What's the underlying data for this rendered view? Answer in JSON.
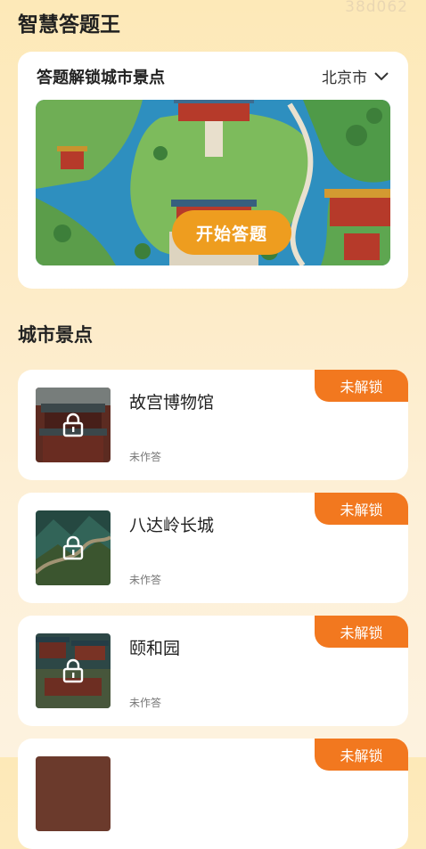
{
  "watermark": "38d062",
  "app": {
    "title": "智慧答题王"
  },
  "hero": {
    "title": "答题解锁城市景点",
    "city": "北京市",
    "start_label": "开始答题"
  },
  "section": {
    "title": "城市景点"
  },
  "spots": [
    {
      "name": "故宫博物馆",
      "status": "未作答",
      "badge": "未解锁"
    },
    {
      "name": "八达岭长城",
      "status": "未作答",
      "badge": "未解锁"
    },
    {
      "name": "颐和园",
      "status": "未作答",
      "badge": "未解锁"
    },
    {
      "name": "",
      "status": "",
      "badge": "未解锁"
    }
  ],
  "colors": {
    "accent": "#ee9d1f",
    "badge": "#f2781f",
    "background": "#fde9b8"
  },
  "icons": {
    "dropdown": "chevron-down-icon",
    "lock": "lock-icon"
  }
}
